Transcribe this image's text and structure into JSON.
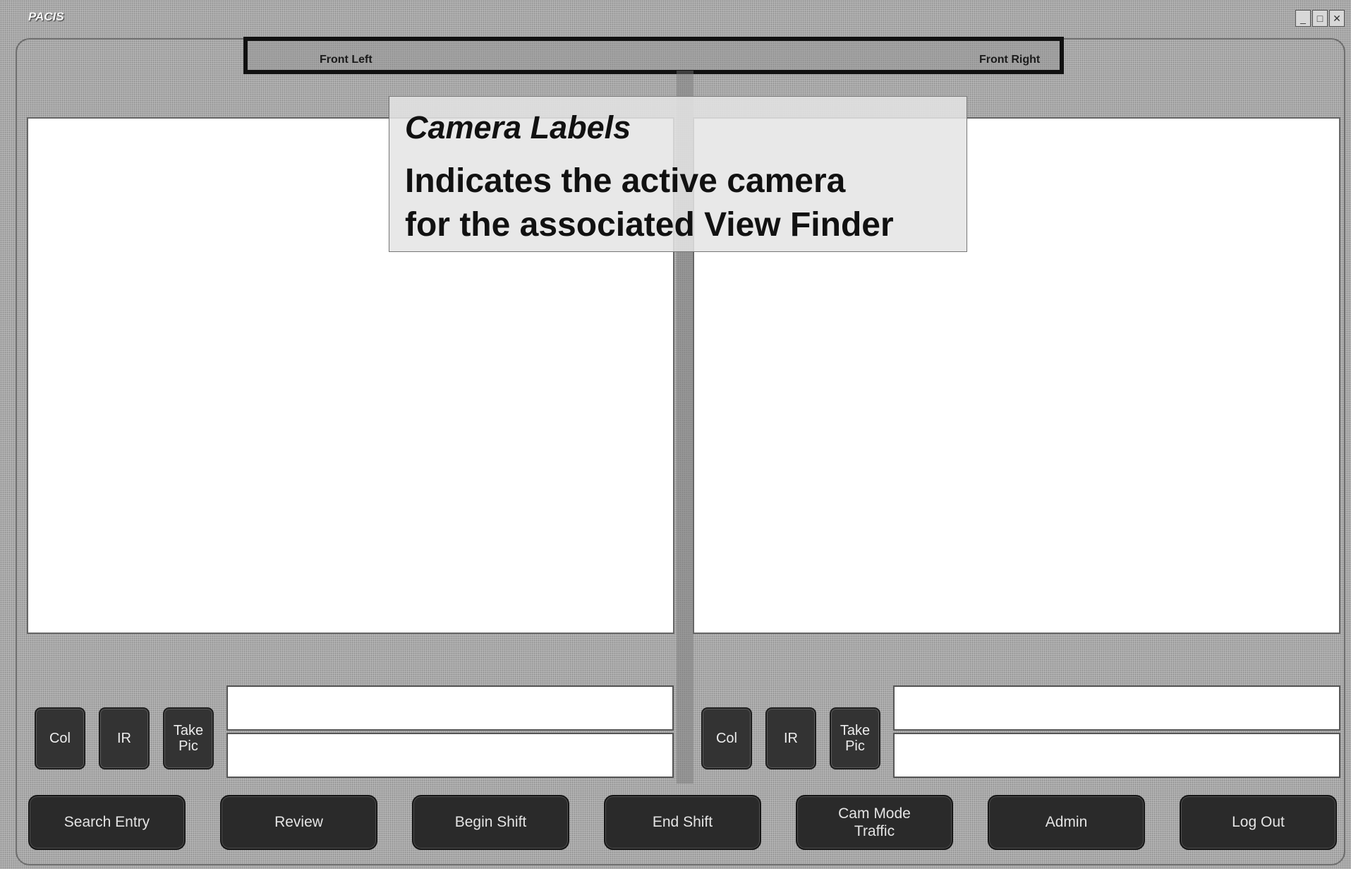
{
  "window": {
    "title": "PACIS",
    "minimize": "_",
    "maximize": "□",
    "close": "✕"
  },
  "camera_labels": {
    "left": "Front Left",
    "right": "Front Right"
  },
  "callout": {
    "title": "Camera Labels",
    "line1": "Indicates the active camera",
    "line2": "for the associated View Finder"
  },
  "left_panel": {
    "col": "Col",
    "ir": "IR",
    "take_pic": "Take\nPic"
  },
  "right_panel": {
    "col": "Col",
    "ir": "IR",
    "take_pic": "Take\nPic"
  },
  "nav": {
    "search_entry": "Search Entry",
    "review": "Review",
    "begin_shift": "Begin Shift",
    "end_shift": "End Shift",
    "cam_mode": "Cam Mode\nTraffic",
    "admin": "Admin",
    "log_out": "Log Out"
  }
}
